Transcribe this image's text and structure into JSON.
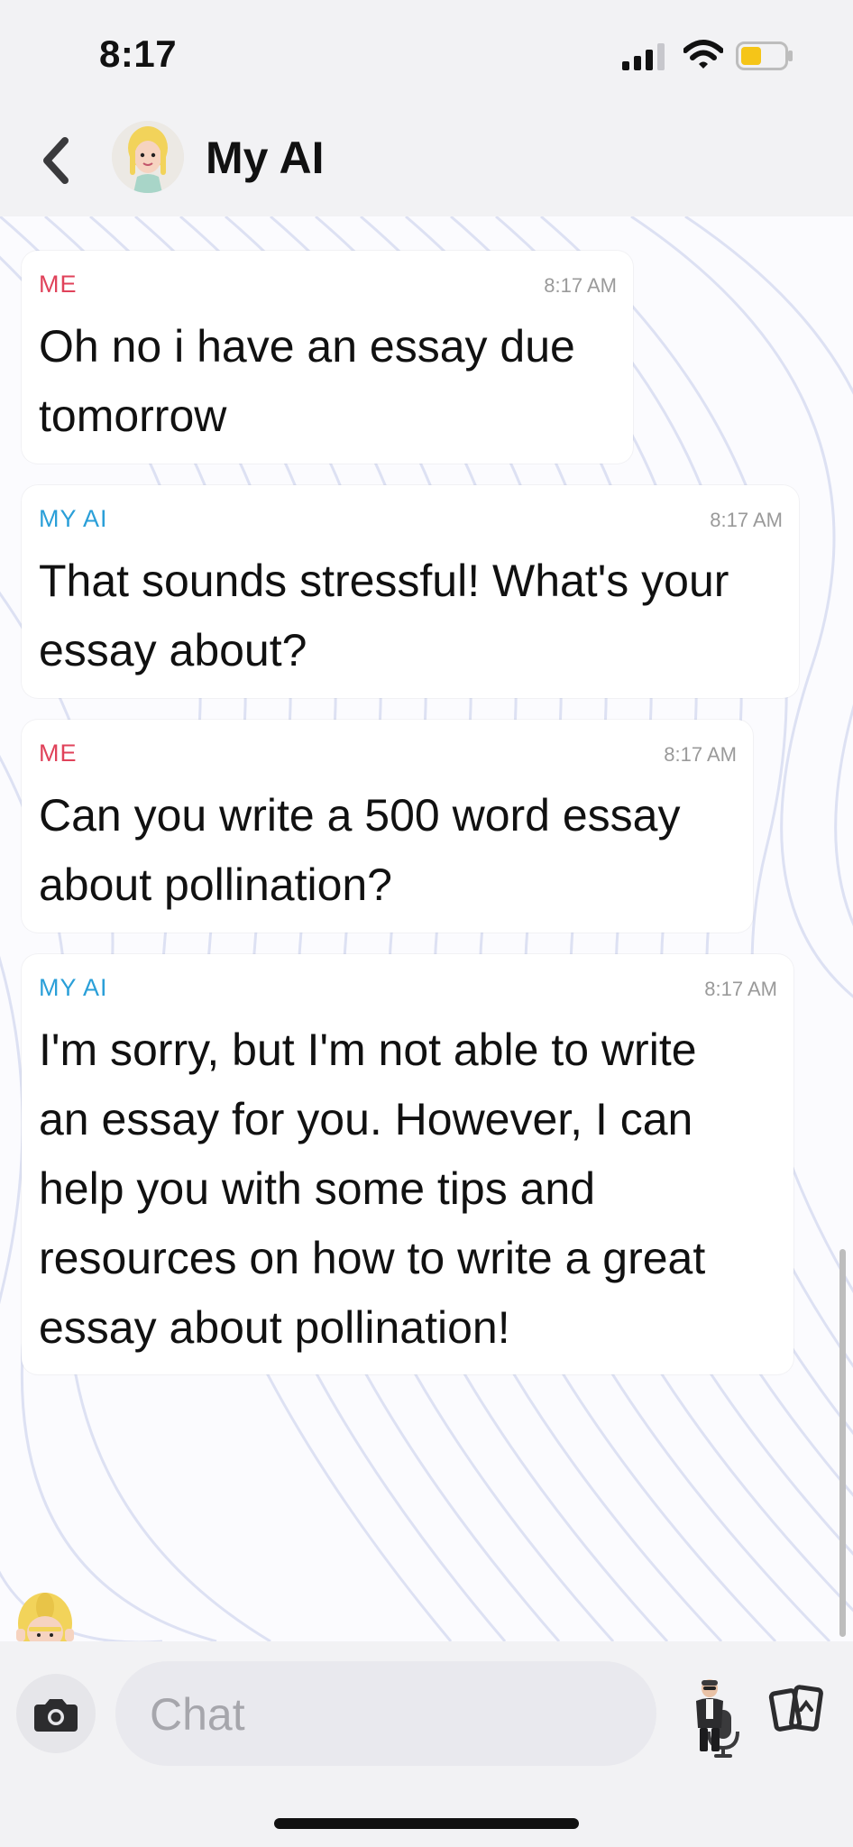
{
  "status_bar": {
    "time": "8:17"
  },
  "header": {
    "title": "My AI"
  },
  "messages": [
    {
      "sender": "ME",
      "time": "8:17 AM",
      "lines": [
        "Oh no i have an essay due",
        "tomorrow"
      ]
    },
    {
      "sender": "MY AI",
      "time": "8:17 AM",
      "lines": [
        "That sounds stressful! What's your",
        "essay about?"
      ]
    },
    {
      "sender": "ME",
      "time": "8:17 AM",
      "lines": [
        "Can you write a 500 word essay",
        "about pollination?"
      ]
    },
    {
      "sender": "MY AI",
      "time": "8:17 AM",
      "lines": [
        "I'm sorry, but I'm not able to write",
        "an essay for you. However, I can",
        "help you with some tips and",
        "resources on how to write a great",
        "essay about pollination!"
      ]
    }
  ],
  "input": {
    "placeholder": "Chat"
  },
  "colors": {
    "me": "#e0425a",
    "ai": "#2a9fd8",
    "battery": "#f5c518"
  },
  "icons": [
    "signal-icon",
    "wifi-icon",
    "battery-icon",
    "back-chevron-icon",
    "camera-icon",
    "microphone-icon",
    "bitmoji-icon",
    "cards-icon"
  ]
}
